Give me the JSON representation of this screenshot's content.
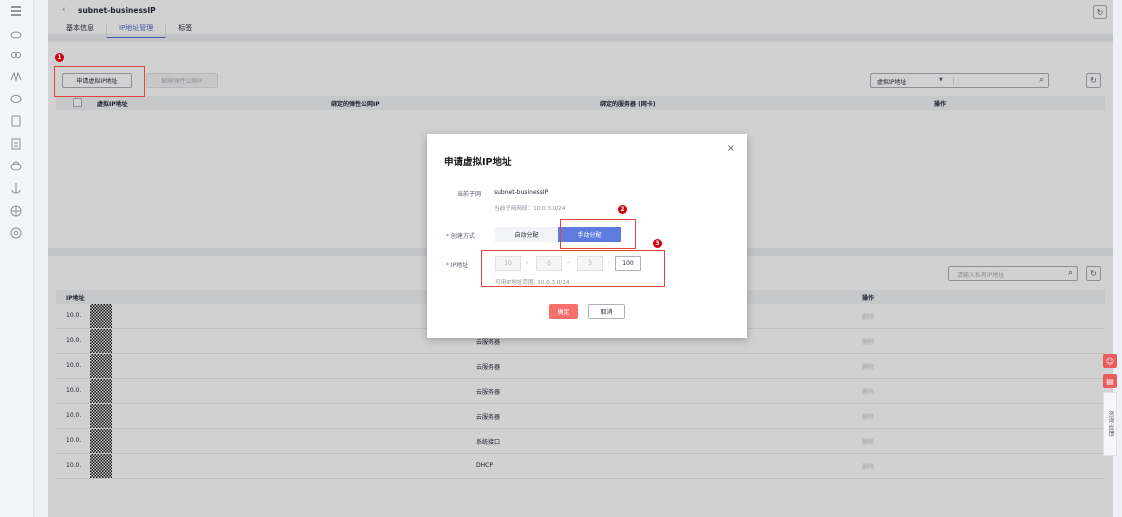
{
  "header": {
    "title": "subnet-businessIP",
    "back_icon": "‹",
    "refresh_icon": "↻",
    "tabs": [
      {
        "label": "基本信息",
        "active": false
      },
      {
        "label": "IP地址管理",
        "active": true
      },
      {
        "label": "标签",
        "active": false
      }
    ]
  },
  "virtual_ip_panel": {
    "apply_button": "申请虚拟IP地址",
    "unbind_button": "解绑弹性公网IP",
    "filter_select": "虚拟IP地址",
    "columns": [
      "虚拟IP地址",
      "绑定的弹性公网IP",
      "绑定的服务器 (网卡)",
      "操作"
    ]
  },
  "ip_panel": {
    "search_placeholder": "请输入私有IP地址",
    "columns": [
      "IP地址",
      "操作"
    ],
    "rows": [
      {
        "ip": "10.0.",
        "server": "",
        "action": "删除"
      },
      {
        "ip": "10.0.",
        "server": "云服务器",
        "action": "删除"
      },
      {
        "ip": "10.0.",
        "server": "云服务器",
        "action": "删除"
      },
      {
        "ip": "10.0.",
        "server": "云服务器",
        "action": "删除"
      },
      {
        "ip": "10.0.",
        "server": "云服务器",
        "action": "删除"
      },
      {
        "ip": "10.0.",
        "server": "系统接口",
        "action": "删除"
      },
      {
        "ip": "10.0.",
        "server": "DHCP",
        "action": "删除"
      }
    ]
  },
  "dialog": {
    "title": "申请虚拟IP地址",
    "close_icon": "×",
    "subnet_label": "当前子网",
    "subnet_value": "subnet-businessIP",
    "subnet_cidr_hint": "当前子网网段：10.0.3.0/24",
    "mode_label": "创建方式",
    "mode_options": [
      "自动分配",
      "手动分配"
    ],
    "mode_selected": "手动分配",
    "ip_label": "IP地址",
    "ip_octets": [
      "10",
      "0",
      "3",
      "100"
    ],
    "ip_range_hint": "可用IP地址范围: 10.0.3.0/24",
    "confirm_button": "确定",
    "cancel_button": "取消",
    "required_mark": "*"
  },
  "annotations": {
    "markers": [
      "1",
      "2",
      "3"
    ],
    "color": "#d4000e"
  },
  "feedback_widget": {
    "label": "咨询·反馈"
  },
  "colors": {
    "accent": "#5e7ce0",
    "confirm": "#f66f6a",
    "highlight": "#e0443a"
  }
}
